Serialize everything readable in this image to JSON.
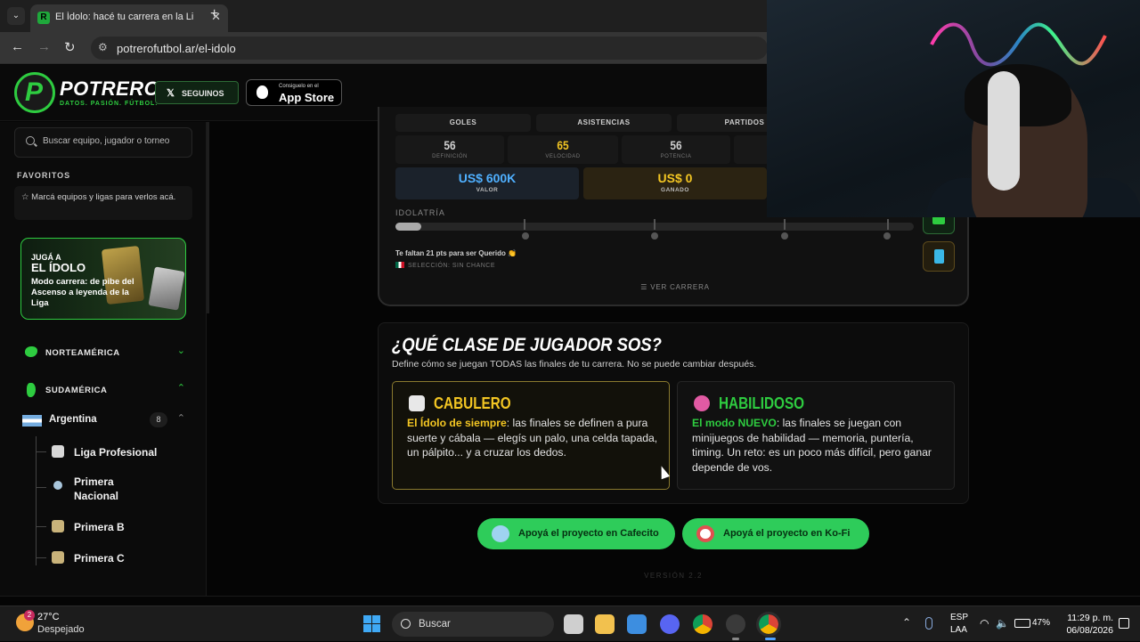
{
  "browser": {
    "tab_title": "El Ídolo: hacé tu carrera en la Li",
    "tab_favicon": "R",
    "tab_close": "✕",
    "new_tab": "+",
    "tabs_menu": "⌄",
    "back": "←",
    "forward": "→",
    "reload": "↻",
    "site_info_icon": "⚙",
    "url": "potrerofutbol.ar/el-idolo"
  },
  "header": {
    "logo_letter": "P",
    "logo_name": "POTRERO",
    "logo_tagline": "DATOS. PASIÓN. FÚTBOL.",
    "follow_icon": "𝕏",
    "follow_label": "SEGUINOS",
    "appstore_small": "Consiguelo en el",
    "appstore_big": "App Store"
  },
  "sidebar": {
    "search_placeholder": "Buscar equipo, jugador o torneo",
    "favorites_title": "FAVORITOS",
    "favorites_empty": "☆  Marcá equipos y ligas para verlos acá.",
    "promo": {
      "kicker": "JUGÁ A",
      "name": "EL ÍDOLO",
      "desc": "Modo carrera: de pibe del Ascenso a leyenda de la Liga"
    },
    "regions": [
      {
        "label": "NORTEAMÉRICA",
        "chevron": "⌄"
      },
      {
        "label": "SUDAMÉRICA",
        "chevron": "⌃"
      }
    ],
    "country": {
      "label": "Argentina",
      "count": "8",
      "chevron": "⌃"
    },
    "leagues": [
      {
        "label": "Liga Profesional"
      },
      {
        "label": "Primera Nacional"
      },
      {
        "label": "Primera B"
      },
      {
        "label": "Primera C"
      }
    ]
  },
  "stats": {
    "labels": [
      "GOLES",
      "ASISTENCIAS",
      "PARTIDOS"
    ],
    "attributes": [
      {
        "value": "56",
        "caption": "DEFINICIÓN"
      },
      {
        "value": "65",
        "caption": "VELOCIDAD"
      },
      {
        "value": "56",
        "caption": "POTENCIA"
      }
    ],
    "money": [
      {
        "value": "US$ 600K",
        "caption": "VALOR",
        "color": "#4fb0ff"
      },
      {
        "value": "US$ 0",
        "caption": "GANADO",
        "color": "#f3c623"
      }
    ],
    "idolatria_label": "IDOLATRÍA",
    "idolatria_progress": 0.05,
    "need_text": "Te faltan 21 pts para ser Querido 👏",
    "selection_text": "SELECCIÓN: SIN CHANCE",
    "ver_carrera": "☰  VER CARRERA"
  },
  "class_section": {
    "title": "¿QUÉ CLASE DE JUGADOR SOS?",
    "subtitle": "Define cómo se juegan TODAS las finales de tu carrera. No se puede cambiar después.",
    "options": [
      {
        "name": "CABULERO",
        "highlight": "El Ídolo de siempre",
        "text": ": las finales se definen a pura suerte y cábala — elegís un palo, una celda tapada, un pálpito... y a cruzar los dedos.",
        "color": "#f3c623",
        "icon": "dice-icon"
      },
      {
        "name": "HABILIDOSO",
        "highlight": "El modo NUEVO",
        "text": ": las finales se juegan con minijuegos de habilidad — memoria, puntería, timing. Un reto: es un poco más difícil, pero ganar depende de vos.",
        "color": "#2ecc40",
        "icon": "brain-icon"
      }
    ]
  },
  "support": {
    "cafecito": "Apoyá el proyecto en Cafecito",
    "kofi": "Apoyá el proyecto en Ko-Fi"
  },
  "version": "VERSIÓN 2.2",
  "taskbar": {
    "weather_badge": "2",
    "weather_temp": "27°C",
    "weather_desc": "Despejado",
    "search_label": "Buscar",
    "tray_up": "⌃",
    "lang1": "ESP",
    "lang2": "LAA",
    "wifi": "◠",
    "volume": "🔈",
    "battery": "47%",
    "time": "11:29 p. m.",
    "date": "06/08/2026"
  }
}
